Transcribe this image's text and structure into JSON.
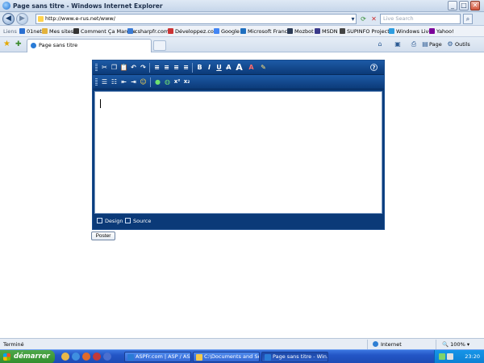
{
  "window": {
    "title": "Page sans titre - Windows Internet Explorer",
    "controls": {
      "minimize": "_",
      "maximize": "□",
      "close": "✕"
    }
  },
  "address_bar": {
    "url": "http://www.e-rus.net/www/",
    "search_placeholder": "Live Search"
  },
  "links_bar": {
    "label": "Liens",
    "items": [
      {
        "label": "01net",
        "icon": "page-icon",
        "color": "#2a6fd1"
      },
      {
        "label": "Mes sites",
        "icon": "folder-icon",
        "color": "#e3b23c"
      },
      {
        "label": "Comment Ça Marche",
        "icon": "page-icon",
        "color": "#333333"
      },
      {
        "label": "csharpfr.com",
        "icon": "page-icon",
        "color": "#3a7bd5"
      },
      {
        "label": "Développez.com",
        "icon": "page-icon",
        "color": "#cc3333"
      },
      {
        "label": "Google",
        "icon": "page-icon",
        "color": "#4285f4"
      },
      {
        "label": "Microsoft France",
        "icon": "page-icon",
        "color": "#1f6fbf"
      },
      {
        "label": "Mozbot",
        "icon": "page-icon",
        "color": "#2b3a55"
      },
      {
        "label": "MSDN",
        "icon": "page-icon",
        "color": "#3a3a8a"
      },
      {
        "label": "SUPINFO Projects",
        "icon": "page-icon",
        "color": "#444444"
      },
      {
        "label": "Windows Live",
        "icon": "page-icon",
        "color": "#2d9de0"
      },
      {
        "label": "Yahoo!",
        "icon": "page-icon",
        "color": "#7b0099"
      }
    ]
  },
  "tab_bar": {
    "active_tab": "Page sans titre",
    "commands": {
      "page": "Page",
      "tools": "Outils"
    }
  },
  "editor": {
    "modes": {
      "design": "Design",
      "source": "Source"
    },
    "toolbar1_icons": [
      "cut-icon",
      "copy-icon",
      "paste-icon",
      "undo-icon",
      "redo-icon",
      "align-left-icon",
      "align-center-icon",
      "align-right-icon",
      "justify-icon",
      "bold-icon",
      "italic-icon",
      "underline-icon",
      "strikethrough-icon",
      "font-size-icon",
      "font-color-icon",
      "highlight-icon",
      "help-icon"
    ],
    "toolbar2_icons": [
      "ordered-list-icon",
      "unordered-list-icon",
      "outdent-icon",
      "indent-icon",
      "smiley-icon",
      "link-icon",
      "unlink-icon",
      "superscript-icon",
      "subscript-icon"
    ],
    "toolbar1_glyphs": {
      "bold": "B",
      "italic": "I",
      "underline": "U",
      "strike": "A̶",
      "size": "A",
      "color": "A",
      "help": "?"
    }
  },
  "form": {
    "submit_label": "Poster"
  },
  "status_bar": {
    "status": "Terminé",
    "zone": "Internet",
    "zoom": "100%"
  },
  "taskbar": {
    "start_label": "démarrer",
    "tasks": [
      {
        "label": "ASPFr.com | ASP / AS..."
      },
      {
        "label": "C:\\Documents and Se..."
      },
      {
        "label": "Page sans titre - Win..."
      }
    ],
    "clock": "23:20"
  }
}
